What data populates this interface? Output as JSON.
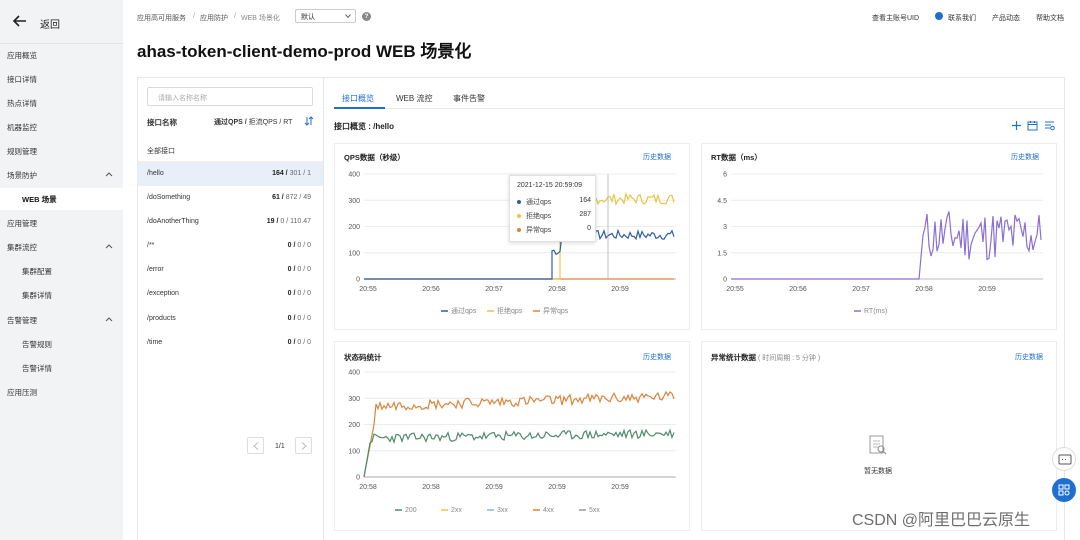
{
  "sidebar": {
    "back_label": "返回",
    "items": [
      {
        "label": "应用概览"
      },
      {
        "label": "接口详情"
      },
      {
        "label": "热点详情"
      },
      {
        "label": "机器监控"
      },
      {
        "label": "规则管理"
      },
      {
        "label": "场景防护"
      },
      {
        "label": "WEB 场景"
      },
      {
        "label": "应用管理"
      },
      {
        "label": "集群流控"
      },
      {
        "label": "集群配置"
      },
      {
        "label": "集群详情"
      },
      {
        "label": "告警管理"
      },
      {
        "label": "告警规则"
      },
      {
        "label": "告警详情"
      },
      {
        "label": "应用压测"
      }
    ]
  },
  "topbar": {
    "breadcrumb": [
      "应用高可用服务",
      "/",
      "应用防护",
      "/",
      "WEB 场景化"
    ],
    "env_select": "默认",
    "links": [
      "查看主账号UID",
      "联系我们",
      "产品动态",
      "帮助文档"
    ]
  },
  "page_title": "ahas-token-client-demo-prod WEB 场景化",
  "left_panel": {
    "search_placeholder": "请输入名称名称",
    "col_name": "接口名称",
    "col_metrics_bold": "通过QPS /",
    "col_metrics_rest": " 拒流QPS / RT",
    "all_label": "全部接口",
    "rows": [
      {
        "name": "/hello",
        "pass": "164 /",
        "rest": " 301 / 1"
      },
      {
        "name": "/doSomething",
        "pass": "61 /",
        "rest": " 872 / 49"
      },
      {
        "name": "/doAnotherThing",
        "pass": "19 /",
        "rest": " 0 / 110.47"
      },
      {
        "name": "/**",
        "pass": "0 /",
        "rest": " 0 / 0"
      },
      {
        "name": "/error",
        "pass": "0 /",
        "rest": " 0 / 0"
      },
      {
        "name": "/exception",
        "pass": "0 /",
        "rest": " 0 / 0"
      },
      {
        "name": "/products",
        "pass": "0 /",
        "rest": " 0 / 0"
      },
      {
        "name": "/time",
        "pass": "0 /",
        "rest": " 0 / 0"
      }
    ],
    "pager": "1/1"
  },
  "tabs": [
    "接口概览",
    "WEB 流控",
    "事件告警"
  ],
  "section_label": "接口概览 : /hello",
  "history_label": "历史数据",
  "tooltip": {
    "time": "2021-12-15 20:59:09",
    "rows": [
      {
        "k": "通过qps",
        "v": "164",
        "color": "#2f5da8"
      },
      {
        "k": "拒绝qps",
        "v": "287",
        "color": "#e8c547"
      },
      {
        "k": "异常qps",
        "v": "0",
        "color": "#d9853b"
      }
    ]
  },
  "no_data": "暂无数据",
  "exception_card": {
    "title": "异常统计数据",
    "subtitle": " ( 时间周期 : 5 分钟 )"
  },
  "watermark": "CSDN @阿里巴巴云原生",
  "chart_data": [
    {
      "type": "line",
      "title": "QPS数据（秒级）",
      "x": [
        "20:55",
        "20:56",
        "20:57",
        "20:58",
        "20:59"
      ],
      "ylim": [
        0,
        400
      ],
      "yticks": [
        "400",
        "300",
        "200",
        "100",
        "0"
      ],
      "series": [
        {
          "name": "通过qps",
          "color": "#2f5da8",
          "approx": "0 until ~20:58, then rises to ~150-180"
        },
        {
          "name": "拒绝qps",
          "color": "#e8c547",
          "approx": "0 until ~20:58:10, then ~280-320"
        },
        {
          "name": "异常qps",
          "color": "#d9853b",
          "approx": "0 throughout"
        }
      ]
    },
    {
      "type": "line",
      "title": "RT数据（ms）",
      "x": [
        "20:55",
        "20:56",
        "20:57",
        "20:58",
        "20:59"
      ],
      "ylim": [
        0,
        6
      ],
      "yticks": [
        "6",
        "4.5",
        "3",
        "1.5",
        "0"
      ],
      "series": [
        {
          "name": "RT(ms)",
          "color": "#8a6fd6",
          "approx": "0 until ~20:58, then fluctuates 1-4"
        }
      ]
    },
    {
      "type": "line",
      "title": "状态码统计",
      "x": [
        "20:58",
        "20:58",
        "20:59",
        "20:59",
        "20:59"
      ],
      "ylim": [
        0,
        400
      ],
      "yticks": [
        "400",
        "300",
        "200",
        "100",
        "0"
      ],
      "series": [
        {
          "name": "200",
          "color": "#4f8a6a",
          "approx": "~130-180"
        },
        {
          "name": "2xx",
          "color": "#e8c547",
          "approx": "0"
        },
        {
          "name": "3xx",
          "color": "#8ab3d9",
          "approx": "0"
        },
        {
          "name": "4xx",
          "color": "#d9853b",
          "approx": "~250-320"
        },
        {
          "name": "5xx",
          "color": "#999999",
          "approx": "0"
        }
      ]
    }
  ]
}
